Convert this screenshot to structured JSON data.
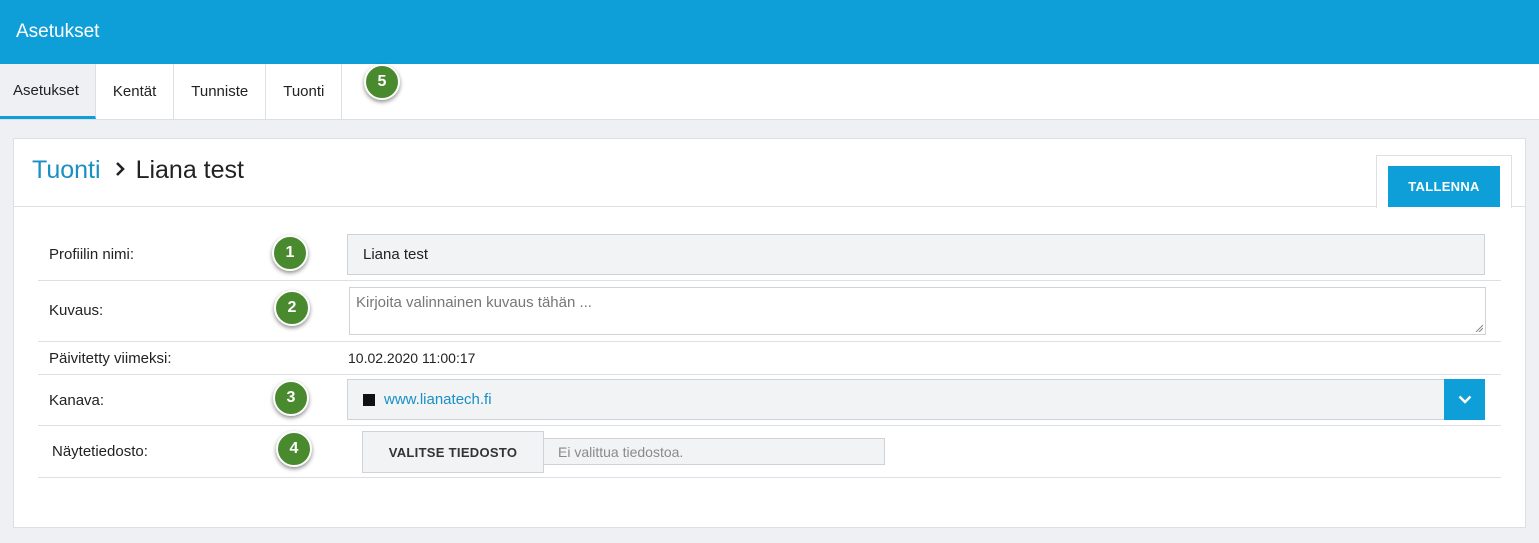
{
  "app": {
    "title": "Asetukset"
  },
  "tabs": [
    {
      "label": "Asetukset",
      "active": true
    },
    {
      "label": "Kentät"
    },
    {
      "label": "Tunniste"
    },
    {
      "label": "Tuonti"
    }
  ],
  "breadcrumb": {
    "parent": "Tuonti",
    "separator": "›",
    "current": "Liana test"
  },
  "toolbar": {
    "save_label": "TALLENNA"
  },
  "form": {
    "profile_name": {
      "label": "Profiilin nimi:",
      "value": "Liana test"
    },
    "description": {
      "label": "Kuvaus:",
      "value": "",
      "placeholder": "Kirjoita valinnainen kuvaus tähän ..."
    },
    "updated": {
      "label": "Päivitetty viimeksi:",
      "value": "10.02.2020 11:00:17"
    },
    "channel": {
      "label": "Kanava:",
      "value": "www.lianatech.fi",
      "swatch_color": "#111111"
    },
    "sample_file": {
      "label": "Näytetiedosto:",
      "button_label": "VALITSE TIEDOSTO",
      "status": "Ei valittua tiedostoa."
    }
  },
  "markers": [
    "1",
    "2",
    "3",
    "4",
    "5"
  ],
  "colors": {
    "accent": "#0f9fd8",
    "link": "#1a8fc4",
    "marker": "#4a8a2e"
  }
}
